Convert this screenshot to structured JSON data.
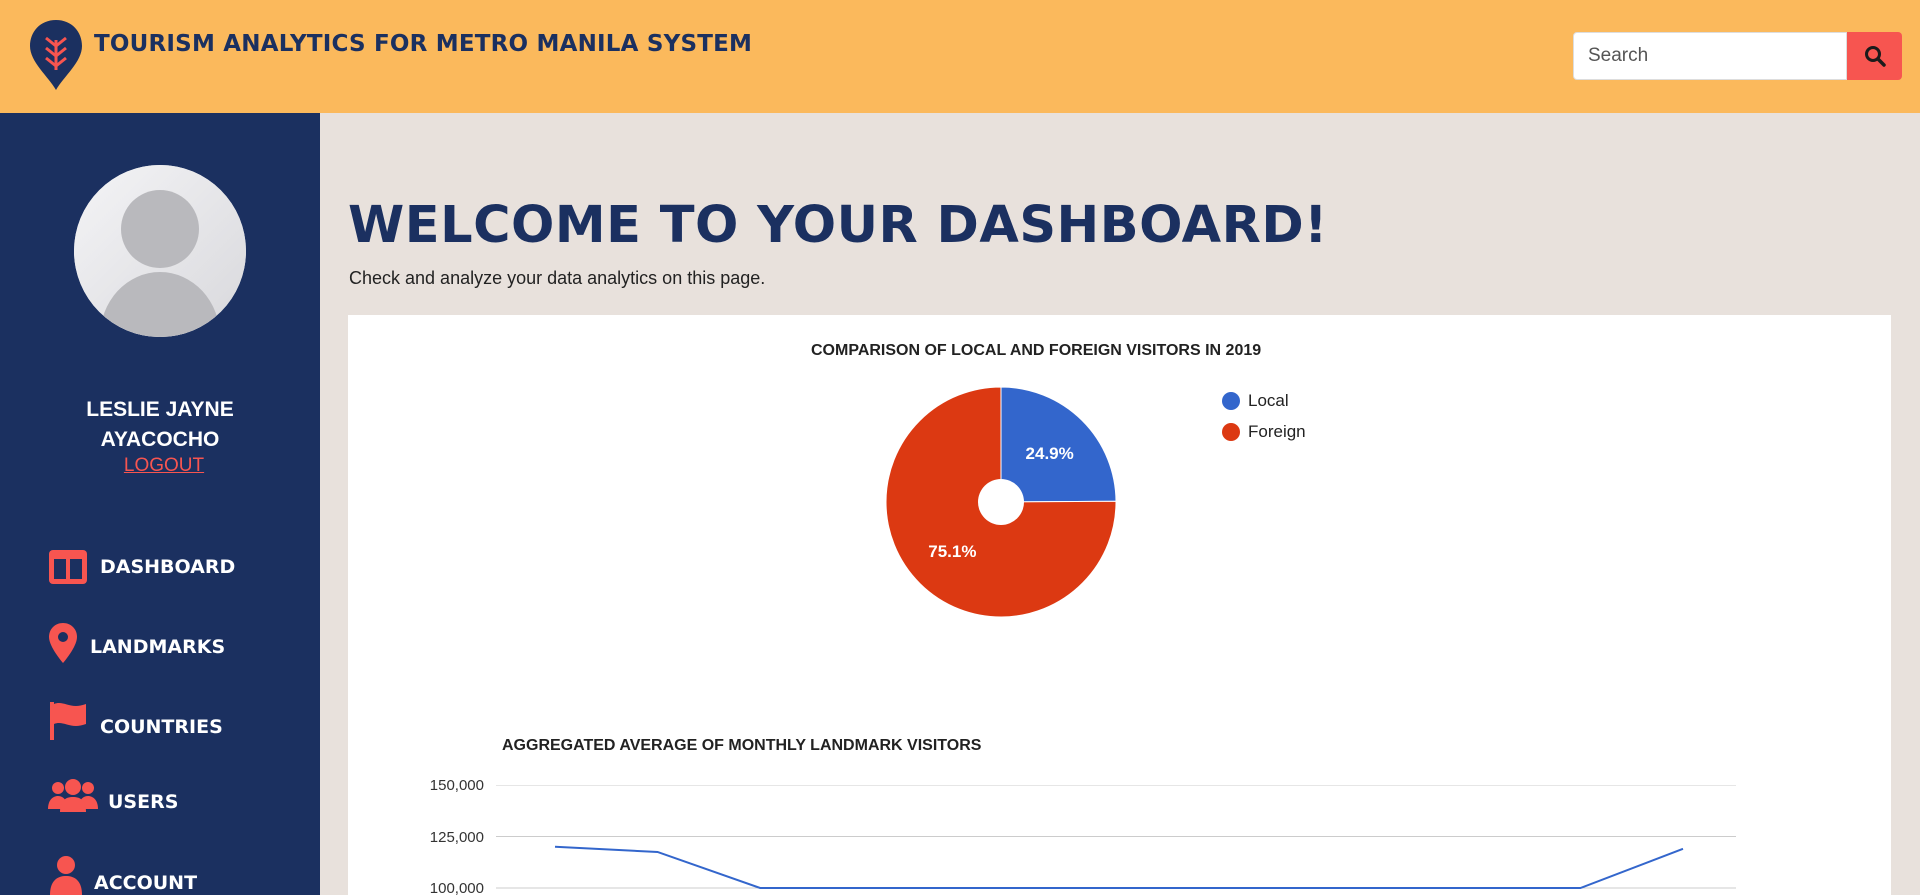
{
  "header": {
    "app_title": "TOURISM ANALYTICS FOR METRO MANILA SYSTEM",
    "search_placeholder": "Search"
  },
  "sidebar": {
    "user_name": "LESLIE JAYNE AYACOCHO",
    "logout_label": "LOGOUT",
    "nav": [
      {
        "label": "DASHBOARD",
        "icon": "dashboard-icon"
      },
      {
        "label": "LANDMARKS",
        "icon": "map-pin-icon"
      },
      {
        "label": "COUNTRIES",
        "icon": "flag-icon"
      },
      {
        "label": "USERS",
        "icon": "users-icon"
      },
      {
        "label": "ACCOUNT",
        "icon": "user-icon"
      }
    ]
  },
  "main": {
    "welcome": "WELCOME TO YOUR DASHBOARD!",
    "subtitle": "Check and analyze your data analytics on this page."
  },
  "colors": {
    "header_bg": "#fbb95c",
    "sidebar_bg": "#1b3060",
    "accent": "#f75550",
    "local": "#3366cc",
    "foreign": "#dc3912"
  },
  "chart_data": [
    {
      "type": "pie",
      "title": "COMPARISON OF LOCAL AND FOREIGN VISITORS IN 2019",
      "labels": [
        "Local",
        "Foreign"
      ],
      "values": [
        24.9,
        75.1
      ],
      "value_labels": [
        "24.9%",
        "75.1%"
      ],
      "legend": "right"
    },
    {
      "type": "line",
      "title": "AGGREGATED AVERAGE OF MONTHLY LANDMARK VISITORS",
      "yticks": [
        "150,000",
        "125,000",
        "100,000"
      ],
      "ylim": [
        100000,
        150000
      ],
      "grid": true,
      "series": [
        {
          "values": [
            120000,
            117500,
            100000,
            100000,
            100000,
            100000,
            100000,
            100000,
            100000,
            100000,
            100000,
            119000
          ]
        }
      ]
    }
  ]
}
